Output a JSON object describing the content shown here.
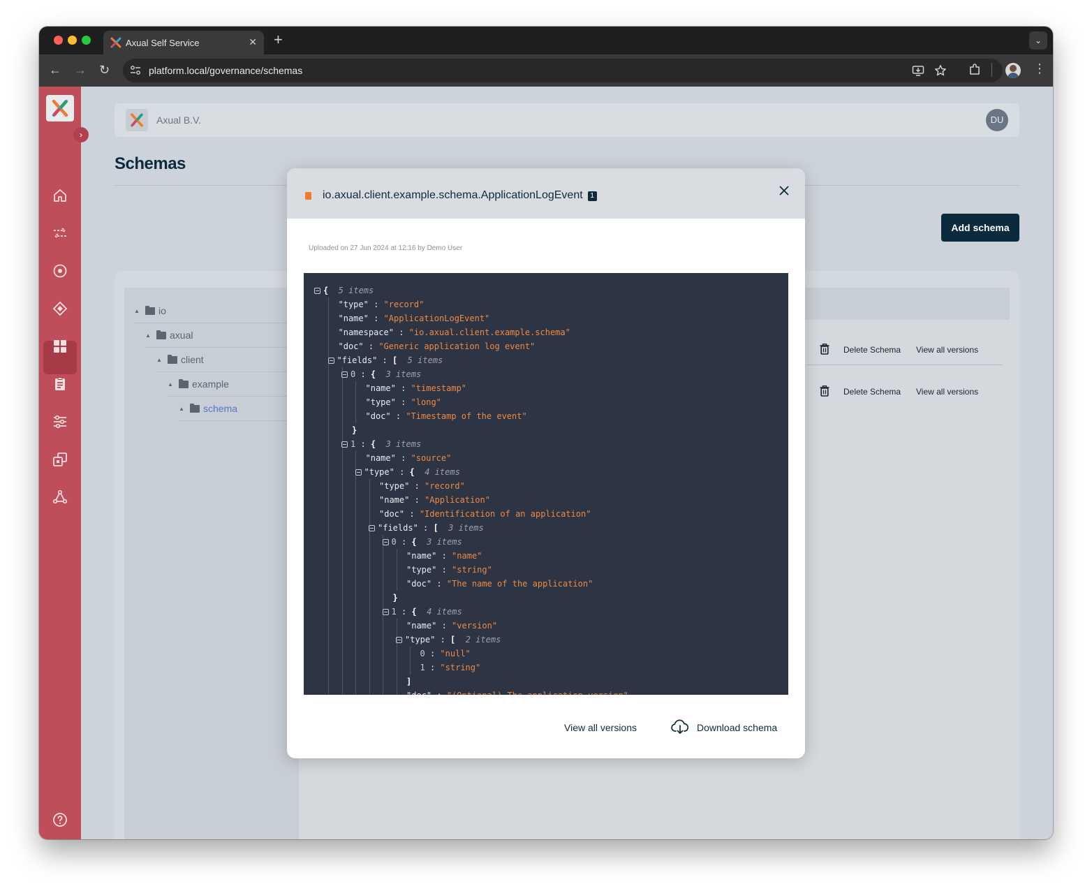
{
  "browser": {
    "tab_title": "Axual Self Service",
    "tab_close": "✕",
    "new_tab": "+",
    "url": "platform.local/governance/schemas"
  },
  "app": {
    "org_name": "Axual B.V.",
    "user_initials": "DU",
    "page_title": "Schemas",
    "add_schema_label": "Add schema",
    "help_icon": "question-circle-icon"
  },
  "tree": {
    "items": [
      {
        "label": "io"
      },
      {
        "label": "axual"
      },
      {
        "label": "client"
      },
      {
        "label": "example"
      },
      {
        "label": "schema"
      }
    ]
  },
  "table": {
    "rows": [
      {
        "delete_label": "Delete Schema",
        "view_label": "View all versions"
      },
      {
        "delete_label": "Delete Schema",
        "view_label": "View all versions"
      }
    ]
  },
  "modal": {
    "title": "io.axual.client.example.schema.ApplicationLogEvent",
    "version": "1",
    "uploaded": "Uploaded on 27 Jun 2024 at 12:16 by Demo User",
    "view_all_versions": "View all versions",
    "download_schema": "Download schema"
  },
  "json_lines": [
    {
      "indent": 0,
      "collapse": true,
      "text": "{",
      "meta": "5 items"
    },
    {
      "indent": 1,
      "key": "\"type\"",
      "value": "\"record\""
    },
    {
      "indent": 1,
      "key": "\"name\"",
      "value": "\"ApplicationLogEvent\""
    },
    {
      "indent": 1,
      "key": "\"namespace\"",
      "value": "\"io.axual.client.example.schema\""
    },
    {
      "indent": 1,
      "key": "\"doc\"",
      "value": "\"Generic application log event\""
    },
    {
      "indent": 1,
      "collapse": true,
      "key": "\"fields\"",
      "text": "[",
      "meta": "5 items"
    },
    {
      "indent": 2,
      "collapse": true,
      "key": "0",
      "num": true,
      "text": "{",
      "meta": "3 items"
    },
    {
      "indent": 3,
      "key": "\"name\"",
      "value": "\"timestamp\""
    },
    {
      "indent": 3,
      "key": "\"type\"",
      "value": "\"long\""
    },
    {
      "indent": 3,
      "key": "\"doc\"",
      "value": "\"Timestamp of the event\""
    },
    {
      "indent": 2,
      "text": "}"
    },
    {
      "indent": 2,
      "collapse": true,
      "key": "1",
      "num": true,
      "text": "{",
      "meta": "3 items"
    },
    {
      "indent": 3,
      "key": "\"name\"",
      "value": "\"source\""
    },
    {
      "indent": 3,
      "collapse": true,
      "key": "\"type\"",
      "text": "{",
      "meta": "4 items"
    },
    {
      "indent": 4,
      "key": "\"type\"",
      "value": "\"record\""
    },
    {
      "indent": 4,
      "key": "\"name\"",
      "value": "\"Application\""
    },
    {
      "indent": 4,
      "key": "\"doc\"",
      "value": "\"Identification of an application\""
    },
    {
      "indent": 4,
      "collapse": true,
      "key": "\"fields\"",
      "text": "[",
      "meta": "3 items"
    },
    {
      "indent": 5,
      "collapse": true,
      "key": "0",
      "num": true,
      "text": "{",
      "meta": "3 items"
    },
    {
      "indent": 6,
      "key": "\"name\"",
      "value": "\"name\""
    },
    {
      "indent": 6,
      "key": "\"type\"",
      "value": "\"string\""
    },
    {
      "indent": 6,
      "key": "\"doc\"",
      "value": "\"The name of the application\""
    },
    {
      "indent": 5,
      "text": "}"
    },
    {
      "indent": 5,
      "collapse": true,
      "key": "1",
      "num": true,
      "text": "{",
      "meta": "4 items"
    },
    {
      "indent": 6,
      "key": "\"name\"",
      "value": "\"version\""
    },
    {
      "indent": 6,
      "collapse": true,
      "key": "\"type\"",
      "text": "[",
      "meta": "2 items"
    },
    {
      "indent": 7,
      "key": "0",
      "num": true,
      "value": "\"null\""
    },
    {
      "indent": 7,
      "key": "1",
      "num": true,
      "value": "\"string\""
    },
    {
      "indent": 6,
      "text": "]"
    },
    {
      "indent": 6,
      "key": "\"doc\"",
      "value": "\"(Optional) The application version\""
    }
  ]
}
